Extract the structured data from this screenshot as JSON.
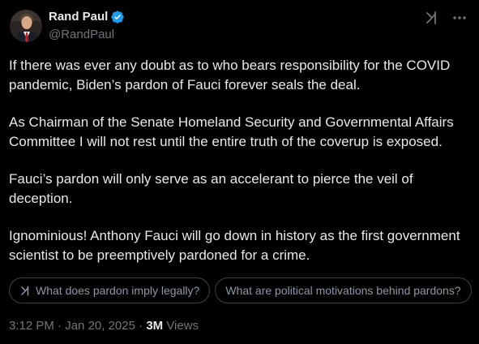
{
  "author": {
    "display_name": "Rand Paul",
    "handle": "@RandPaul",
    "verified": true
  },
  "tweet": {
    "paragraphs": [
      "If there was ever any doubt as to who bears responsibility for the COVID pandemic, Biden’s pardon of Fauci forever seals the deal.",
      "As Chairman of the Senate Homeland Security and Governmental Affairs Committee I will not rest until the entire truth of the coverup is exposed.",
      "Fauci’s pardon will only serve as an accelerant to pierce the veil of deception.",
      "Ignominious! Anthony Fauci will go down in history as the first government scientist to be preemptively pardoned for a crime."
    ]
  },
  "grok_suggestions": [
    "What does pardon imply legally?",
    "What are political motivations behind pardons?"
  ],
  "meta": {
    "time": "3:12 PM",
    "separator": "·",
    "date": "Jan 20, 2025",
    "views_count": "3M",
    "views_label": "Views"
  },
  "icons": {
    "verified": "verified-badge-icon",
    "grok": "grok-icon",
    "more": "more-horizontal-icon"
  },
  "colors": {
    "background": "#000000",
    "text_primary": "#e7e9ea",
    "text_secondary": "#71767b",
    "verified_blue": "#1d9bf0",
    "chip_border": "#3e4144"
  }
}
